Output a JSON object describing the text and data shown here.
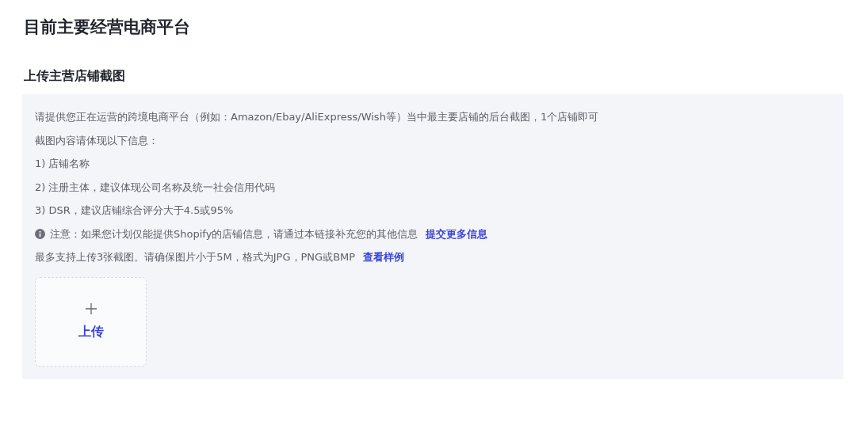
{
  "title": "目前主要经营电商平台",
  "section": {
    "title": "上传主营店铺截图",
    "lines": [
      {
        "kind": "text",
        "text": "请提供您正在运营的跨境电商平台（例如：Amazon/Ebay/AliExpress/Wish等）当中最主要店铺的后台截图，1个店铺即可"
      },
      {
        "kind": "text",
        "text": "截图内容请体现以下信息："
      },
      {
        "kind": "text",
        "text": "1) 店铺名称"
      },
      {
        "kind": "text",
        "text": "2) 注册主体，建议体现公司名称及统一社会信用代码"
      },
      {
        "kind": "text",
        "text": "3) DSR，建议店铺综合评分大于4.5或95%"
      },
      {
        "kind": "notice",
        "text": "注意：如果您计划仅能提供Shopify的店铺信息，请通过本链接补充您的其他信息",
        "link": "提交更多信息"
      },
      {
        "kind": "rule",
        "text": "最多支持上传3张截图。请确保图片小于5M，格式为JPG，PNG或BMP",
        "link": "查看样例"
      }
    ],
    "upload": {
      "label": "上传"
    }
  }
}
